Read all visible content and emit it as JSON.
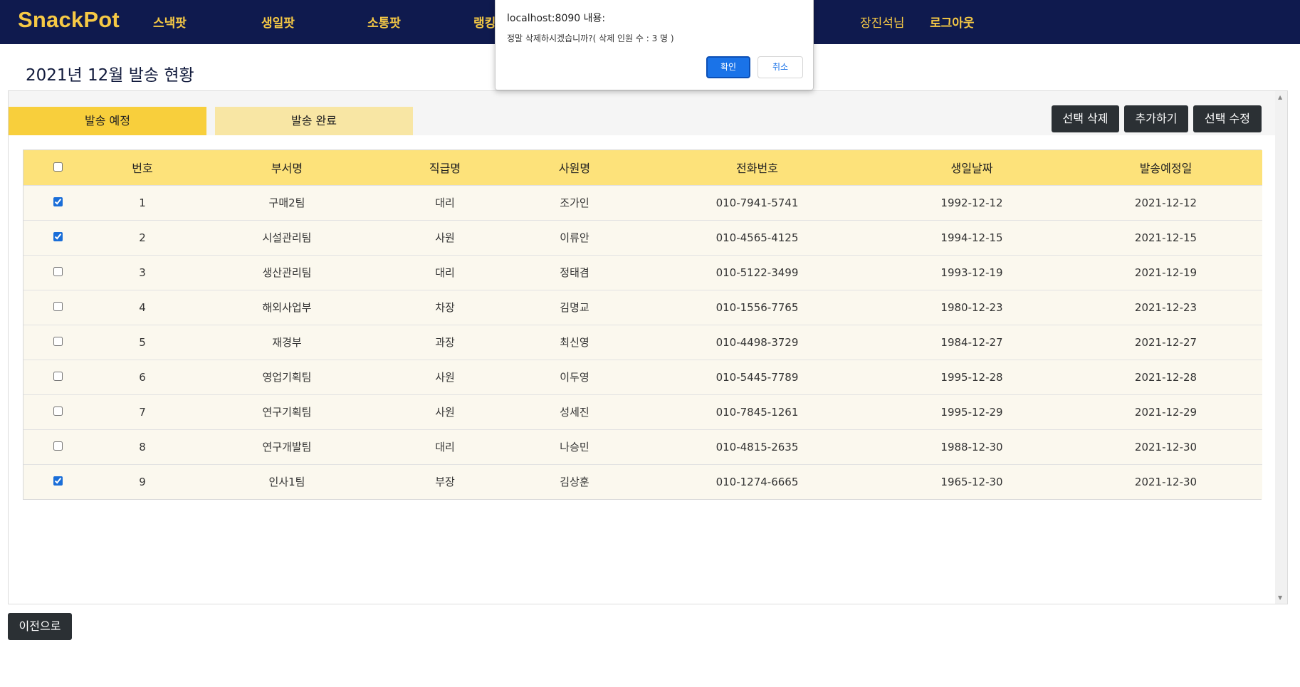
{
  "nav": {
    "logo": "SnackPot",
    "items": [
      "스낵팟",
      "생일팟",
      "소통팟",
      "랭킹"
    ],
    "user": "장진석님",
    "logout": "로그아웃"
  },
  "page": {
    "title": "2021년 12월 발송 현황"
  },
  "tabs": [
    "발송 예정",
    "발송 완료"
  ],
  "actions": {
    "delete_selected": "선택 삭제",
    "add": "추가하기",
    "edit_selected": "선택 수정"
  },
  "table": {
    "headers": [
      "번호",
      "부서명",
      "직급명",
      "사원명",
      "전화번호",
      "생일날짜",
      "발송예정일"
    ],
    "rows": [
      {
        "checked": true,
        "no": "1",
        "dept": "구매2팀",
        "rank": "대리",
        "name": "조가인",
        "phone": "010-7941-5741",
        "birth": "1992-12-12",
        "send": "2021-12-12"
      },
      {
        "checked": true,
        "no": "2",
        "dept": "시설관리팀",
        "rank": "사원",
        "name": "이류안",
        "phone": "010-4565-4125",
        "birth": "1994-12-15",
        "send": "2021-12-15"
      },
      {
        "checked": false,
        "no": "3",
        "dept": "생산관리팀",
        "rank": "대리",
        "name": "정태겸",
        "phone": "010-5122-3499",
        "birth": "1993-12-19",
        "send": "2021-12-19"
      },
      {
        "checked": false,
        "no": "4",
        "dept": "해외사업부",
        "rank": "차장",
        "name": "김명교",
        "phone": "010-1556-7765",
        "birth": "1980-12-23",
        "send": "2021-12-23"
      },
      {
        "checked": false,
        "no": "5",
        "dept": "재경부",
        "rank": "과장",
        "name": "최신영",
        "phone": "010-4498-3729",
        "birth": "1984-12-27",
        "send": "2021-12-27"
      },
      {
        "checked": false,
        "no": "6",
        "dept": "영업기획팀",
        "rank": "사원",
        "name": "이두영",
        "phone": "010-5445-7789",
        "birth": "1995-12-28",
        "send": "2021-12-28"
      },
      {
        "checked": false,
        "no": "7",
        "dept": "연구기획팀",
        "rank": "사원",
        "name": "성세진",
        "phone": "010-7845-1261",
        "birth": "1995-12-29",
        "send": "2021-12-29"
      },
      {
        "checked": false,
        "no": "8",
        "dept": "연구개발팀",
        "rank": "대리",
        "name": "나승민",
        "phone": "010-4815-2635",
        "birth": "1988-12-30",
        "send": "2021-12-30"
      },
      {
        "checked": true,
        "no": "9",
        "dept": "인사1팀",
        "rank": "부장",
        "name": "김상훈",
        "phone": "010-1274-6665",
        "birth": "1965-12-30",
        "send": "2021-12-30"
      }
    ]
  },
  "back_button": "이전으로",
  "dialog": {
    "origin": "localhost:8090 내용:",
    "message": "정말 삭제하시겠습니까?( 삭제 인원 수 : 3 명 )",
    "ok": "확인",
    "cancel": "취소"
  },
  "colors": {
    "nav_bg": "#0f1a4e",
    "accent": "#f6c945",
    "tab_active": "#f8cf3c",
    "tab_inactive": "#f8e6a4",
    "table_header": "#fde27a",
    "row_bg": "#fbf8ee",
    "dark_button": "#2b3034",
    "dialog_ok": "#1a73e8"
  }
}
